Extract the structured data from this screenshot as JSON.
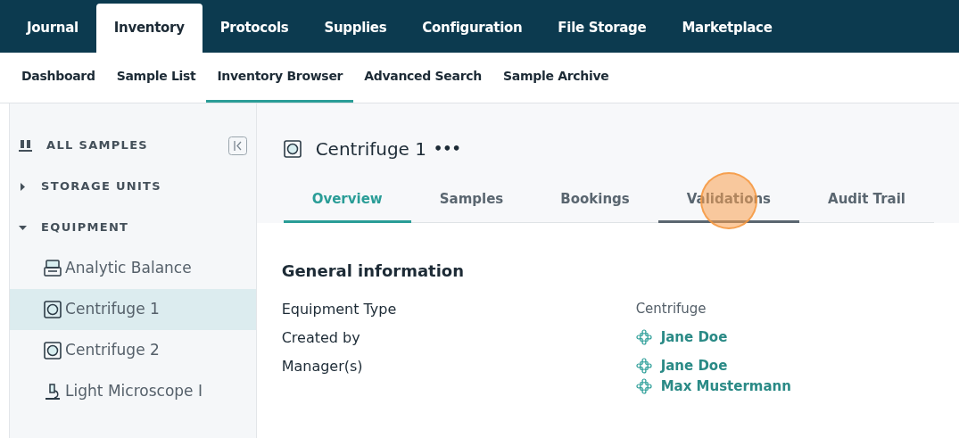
{
  "top_tabs": [
    {
      "label": "Journal",
      "selected": false
    },
    {
      "label": "Inventory",
      "selected": true
    },
    {
      "label": "Protocols",
      "selected": false
    },
    {
      "label": "Supplies",
      "selected": false
    },
    {
      "label": "Configuration",
      "selected": false
    },
    {
      "label": "File Storage",
      "selected": false
    },
    {
      "label": "Marketplace",
      "selected": false
    }
  ],
  "sub_tabs": [
    {
      "label": "Dashboard",
      "selected": false
    },
    {
      "label": "Sample List",
      "selected": false
    },
    {
      "label": "Inventory Browser",
      "selected": true
    },
    {
      "label": "Advanced Search",
      "selected": false
    },
    {
      "label": "Sample Archive",
      "selected": false
    }
  ],
  "sidebar": {
    "all_samples": "ALL SAMPLES",
    "sections": [
      {
        "label": "STORAGE UNITS",
        "expanded": false
      },
      {
        "label": "EQUIPMENT",
        "expanded": true,
        "children": [
          {
            "label": "Analytic Balance",
            "kind": "balance",
            "selected": false
          },
          {
            "label": "Centrifuge 1",
            "kind": "centrifuge",
            "selected": true
          },
          {
            "label": "Centrifuge 2",
            "kind": "centrifuge",
            "selected": false
          },
          {
            "label": "Light Microscope I",
            "kind": "microscope",
            "selected": false
          }
        ]
      }
    ]
  },
  "detail": {
    "title": "Centrifuge 1",
    "more": "•••",
    "tabs": [
      {
        "label": "Overview",
        "selected": true,
        "hovered": false
      },
      {
        "label": "Samples",
        "selected": false,
        "hovered": false
      },
      {
        "label": "Bookings",
        "selected": false,
        "hovered": false
      },
      {
        "label": "Validations",
        "selected": false,
        "hovered": true
      },
      {
        "label": "Audit Trail",
        "selected": false,
        "hovered": false
      }
    ],
    "section_title": "General information",
    "fields": [
      {
        "label": "Equipment Type",
        "kind": "text",
        "values": [
          "Centrifuge"
        ]
      },
      {
        "label": "Created by",
        "kind": "users",
        "values": [
          "Jane Doe"
        ]
      },
      {
        "label": "Manager(s)",
        "kind": "users",
        "values": [
          "Jane Doe",
          "Max Mustermann"
        ]
      }
    ]
  }
}
